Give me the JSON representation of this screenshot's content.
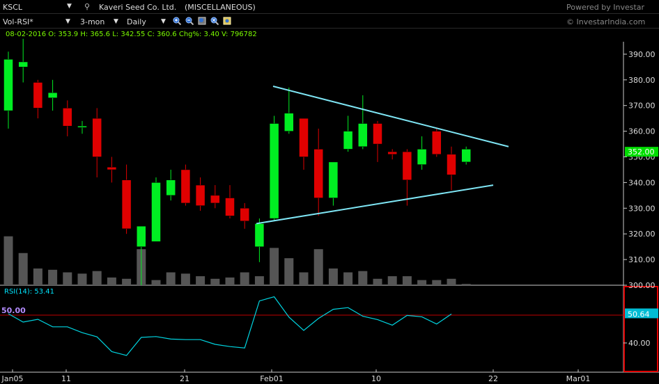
{
  "header": {
    "symbol": "KSCL",
    "company": "Kaveri Seed Co. Ltd.",
    "category": "(MISCELLANEOUS)",
    "powered": "Powered by Investar",
    "website": "© InvestarIndia.com"
  },
  "toolbar": {
    "indicator": "Vol-RSI*",
    "range": "3-mon",
    "interval": "Daily",
    "icons": [
      "zoom-in-icon",
      "zoom-out-icon",
      "zoom-fit-icon",
      "zoom-reset-icon",
      "settings-icon"
    ]
  },
  "ohlc": {
    "text": "08-02-2016  O: 353.9  H: 365.6  L: 342.55  C: 360.6  Chg%: 3.40  V: 796782"
  },
  "rsi": {
    "label": "RSI(14):",
    "value": "53.41",
    "level_label": "50.00",
    "current_label": "50.64",
    "tick": "40.00"
  },
  "colors": {
    "up": "#00ee22",
    "down": "#e00000",
    "trendline": "#7fe6f5",
    "rsi_line": "#00d4e0",
    "rsi_level": "#c00000",
    "price_tag": "#00dd00",
    "volume": "#555555"
  },
  "chart_data": {
    "type": "candlestick",
    "price_ticks": [
      "390.00",
      "380.00",
      "370.00",
      "360.00",
      "350.00",
      "340.00",
      "330.00",
      "320.00",
      "310.00",
      "300.00"
    ],
    "last_price": "352.00",
    "x_ticks": [
      "Jan05",
      "11",
      "21",
      "Feb01",
      "10",
      "22",
      "Mar01"
    ],
    "candles": [
      {
        "o": 368,
        "h": 391,
        "l": 361,
        "c": 388
      },
      {
        "o": 385,
        "h": 396,
        "l": 379,
        "c": 387
      },
      {
        "o": 379,
        "h": 380,
        "l": 365,
        "c": 369
      },
      {
        "o": 373,
        "h": 380,
        "l": 368,
        "c": 375
      },
      {
        "o": 369,
        "h": 372,
        "l": 358,
        "c": 362
      },
      {
        "o": 362,
        "h": 364,
        "l": 359,
        "c": 362
      },
      {
        "o": 365,
        "h": 369,
        "l": 342,
        "c": 350
      },
      {
        "o": 346,
        "h": 350,
        "l": 340,
        "c": 345
      },
      {
        "o": 341,
        "h": 347,
        "l": 320,
        "c": 322
      },
      {
        "o": 315,
        "h": 323,
        "l": 300,
        "c": 323
      },
      {
        "o": 317,
        "h": 342,
        "l": 317,
        "c": 340
      },
      {
        "o": 335,
        "h": 345,
        "l": 333,
        "c": 341
      },
      {
        "o": 345,
        "h": 347,
        "l": 331,
        "c": 332
      },
      {
        "o": 339,
        "h": 342,
        "l": 329,
        "c": 331
      },
      {
        "o": 335,
        "h": 339,
        "l": 330,
        "c": 332
      },
      {
        "o": 334,
        "h": 339,
        "l": 326,
        "c": 327
      },
      {
        "o": 330,
        "h": 332,
        "l": 322,
        "c": 325
      },
      {
        "o": 315,
        "h": 326,
        "l": 309,
        "c": 324
      },
      {
        "o": 326,
        "h": 366,
        "l": 325,
        "c": 363
      },
      {
        "o": 360,
        "h": 377,
        "l": 359,
        "c": 367
      },
      {
        "o": 365,
        "h": 365,
        "l": 345,
        "c": 350
      },
      {
        "o": 353,
        "h": 361,
        "l": 327,
        "c": 334
      },
      {
        "o": 334,
        "h": 348,
        "l": 331,
        "c": 348
      },
      {
        "o": 353,
        "h": 366,
        "l": 352,
        "c": 360
      },
      {
        "o": 354,
        "h": 374,
        "l": 353,
        "c": 363
      },
      {
        "o": 363,
        "h": 364,
        "l": 348,
        "c": 355
      },
      {
        "o": 352,
        "h": 353,
        "l": 349,
        "c": 351
      },
      {
        "o": 352,
        "h": 353,
        "l": 331,
        "c": 341
      },
      {
        "o": 347,
        "h": 358,
        "l": 345,
        "c": 353
      },
      {
        "o": 360,
        "h": 361,
        "l": 350,
        "c": 351
      },
      {
        "o": 351,
        "h": 354,
        "l": 337,
        "c": 343
      },
      {
        "o": 348,
        "h": 354,
        "l": 347,
        "c": 353
      }
    ],
    "volume": [
      38,
      25,
      13,
      12,
      10,
      9,
      11,
      6,
      5,
      28,
      4,
      10,
      9,
      7,
      5,
      6,
      10,
      7,
      29,
      21,
      10,
      28,
      13,
      10,
      11,
      5,
      7,
      7,
      4,
      4,
      5,
      1
    ],
    "rsi": [
      50.5,
      47.5,
      48.5,
      45.8,
      45.8,
      43.7,
      42.2,
      36.9,
      35.5,
      42.0,
      42.3,
      41.4,
      41.2,
      41.2,
      39.5,
      38.7,
      38.2,
      55.1,
      56.6,
      49.3,
      44.5,
      48.8,
      52.1,
      52.7,
      49.6,
      48.4,
      46.4,
      49.9,
      49.4,
      46.8,
      50.4
    ]
  }
}
